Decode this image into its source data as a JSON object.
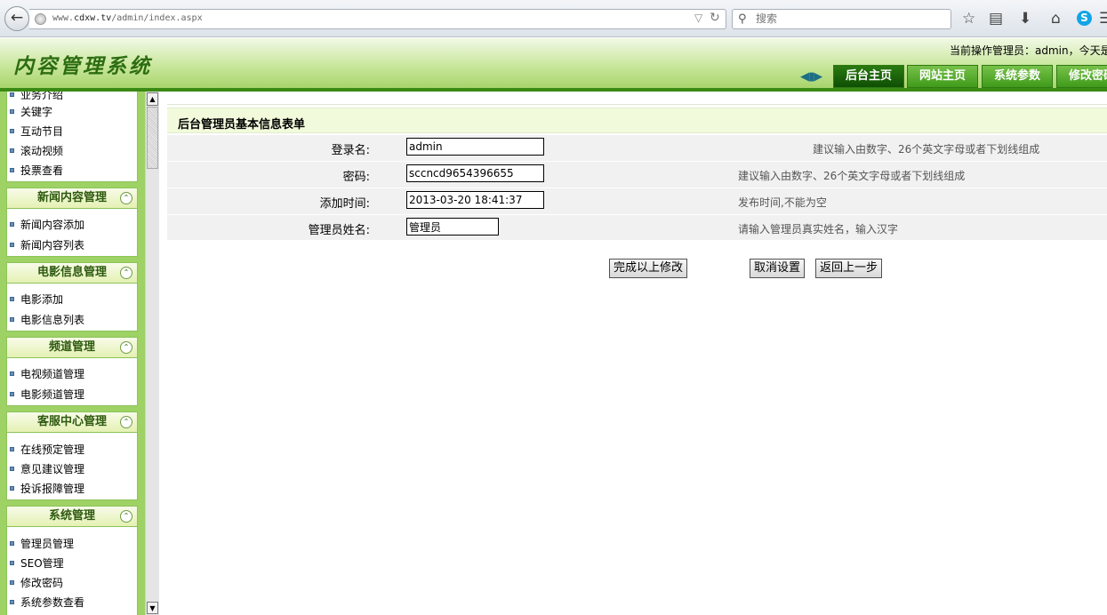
{
  "browser": {
    "url_prefix": "www.",
    "url_domain": "cdxw.tv",
    "url_path": "/admin/index.aspx",
    "search_placeholder": "搜索"
  },
  "header": {
    "logo": "内容管理系统",
    "admin_info": "当前操作管理员：admin，今天是："
  },
  "top_nav": [
    {
      "label": "后台主页",
      "active": true
    },
    {
      "label": "网站主页",
      "active": false
    },
    {
      "label": "系统参数",
      "active": false
    },
    {
      "label": "修改密码",
      "active": false
    }
  ],
  "sidebar": {
    "top_items": [
      "业务介绍",
      "关键字",
      "互动节目",
      "滚动视频",
      "投票查看"
    ],
    "groups": [
      {
        "title": "新闻内容管理",
        "items": [
          "新闻内容添加",
          "新闻内容列表"
        ]
      },
      {
        "title": "电影信息管理",
        "items": [
          "电影添加",
          "电影信息列表"
        ]
      },
      {
        "title": "频道管理",
        "items": [
          "电视频道管理",
          "电影频道管理"
        ]
      },
      {
        "title": "客服中心管理",
        "items": [
          "在线预定管理",
          "意见建议管理",
          "投诉报障管理"
        ]
      },
      {
        "title": "系统管理",
        "items": [
          "管理员管理",
          "SEO管理",
          "修改密码",
          "系统参数查看"
        ]
      }
    ]
  },
  "form": {
    "title": "后台管理员基本信息表单",
    "fields": [
      {
        "label": "登录名:",
        "value": "admin",
        "hint": "建议输入由数字、26个英文字母或者下划线组成"
      },
      {
        "label": "密码:",
        "value": "sccncd9654396655",
        "hint": "建议输入由数字、26个英文字母或者下划线组成"
      },
      {
        "label": "添加时间:",
        "value": "2013-03-20 18:41:37",
        "hint": "发布时间,不能为空"
      },
      {
        "label": "管理员姓名:",
        "value": "管理员",
        "hint": "请输入管理员真实姓名，输入汉字"
      }
    ],
    "buttons": {
      "submit": "完成以上修改",
      "cancel": "取消设置",
      "back": "返回上一步"
    }
  }
}
